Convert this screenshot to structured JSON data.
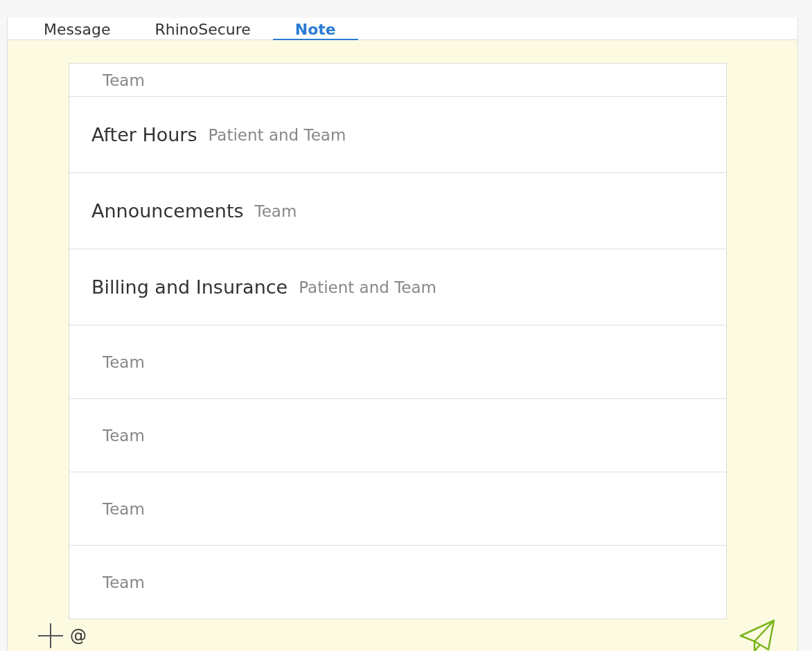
{
  "tabs": [
    {
      "label": "Message",
      "selected": false
    },
    {
      "label": "RhinoSecure",
      "selected": false
    },
    {
      "label": "Note",
      "selected": true
    }
  ],
  "channels": [
    {
      "audience": "Team"
    },
    {
      "name": "After Hours",
      "audience": "Patient and Team"
    },
    {
      "name": "Announcements",
      "audience": "Team"
    },
    {
      "name": "Billing and Insurance",
      "audience": "Patient and Team"
    },
    {
      "audience": "Team"
    },
    {
      "audience": "Team"
    },
    {
      "audience": "Team"
    },
    {
      "audience": "Team"
    }
  ],
  "composer": {
    "mention": "@"
  }
}
